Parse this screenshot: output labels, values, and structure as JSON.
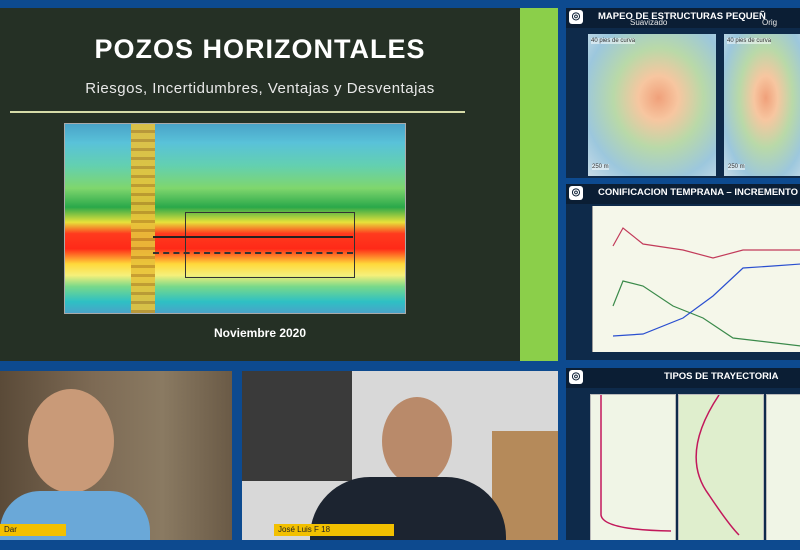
{
  "main_slide": {
    "title": "POZOS HORIZONTALES",
    "subtitle": "Riesgos, Incertidumbres, Ventajas y Desventajas",
    "date": "Noviembre 2020"
  },
  "side_slides": [
    {
      "header": "MAPEO DE ESTRUCTURAS PEQUEÑ",
      "panel_left_label": "Suavizado",
      "panel_right_label": "Orig",
      "note_left": "40 pies de curva",
      "note_right": "40 pies de curva",
      "scale_left": "250 m",
      "scale_right": "250 m"
    },
    {
      "header": "CONIFICACION TEMPRANA – INCREMENTO"
    },
    {
      "header": "TIPOS DE TRAYECTORIA"
    }
  ],
  "participants": [
    {
      "name": "Dar"
    },
    {
      "name": "José Luis F 18"
    }
  ],
  "colors": {
    "namebar": "#f2c000",
    "frame": "#0d4a8f",
    "slide_accent": "#8bcf4a"
  }
}
